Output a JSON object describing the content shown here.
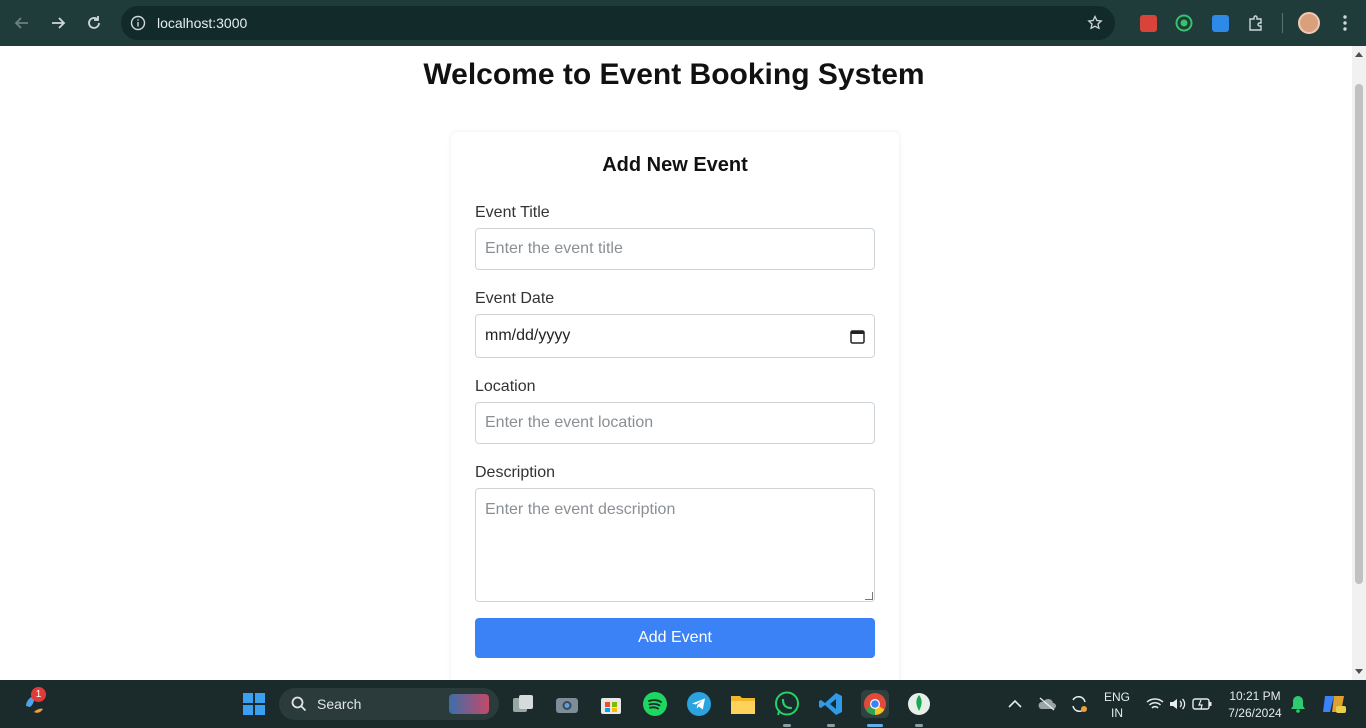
{
  "browser": {
    "url": "localhost:3000"
  },
  "page": {
    "title": "Welcome to Event Booking System"
  },
  "form": {
    "heading": "Add New Event",
    "title_label": "Event Title",
    "title_placeholder": "Enter the event title",
    "date_label": "Event Date",
    "date_value": "mm/dd/yyyy",
    "location_label": "Location",
    "location_placeholder": "Enter the event location",
    "description_label": "Description",
    "description_placeholder": "Enter the event description",
    "submit_label": "Add Event"
  },
  "taskbar": {
    "notification_count": "1",
    "search_label": "Search",
    "language_line1": "ENG",
    "language_line2": "IN",
    "time": "10:21 PM",
    "date": "7/26/2024"
  },
  "colors": {
    "browser_bar": "#1f3b3a",
    "primary_button": "#3b82f6",
    "taskbar": "#1b2a2a"
  }
}
